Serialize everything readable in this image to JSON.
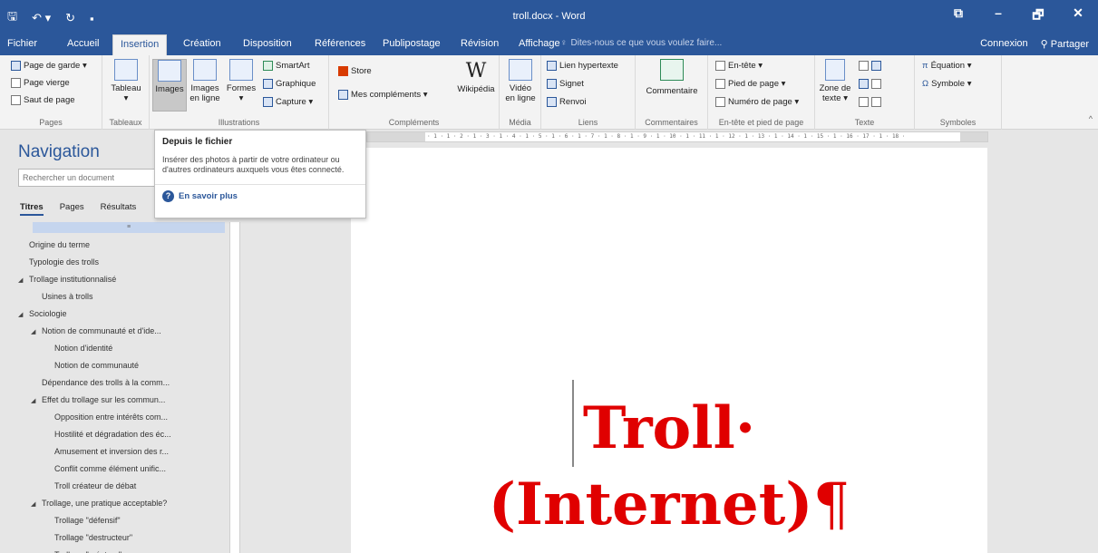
{
  "titlebar": {
    "doc_title": "troll.docx - Word",
    "qat_save": "🖫",
    "qat_undo": "↶ ▾",
    "qat_redo": "↻",
    "qat_more": "▪",
    "restore": "⧉",
    "minimize": "–",
    "maximize": "🗗",
    "close": "✕"
  },
  "tabs": {
    "fichier": "Fichier",
    "accueil": "Accueil",
    "insertion": "Insertion",
    "creation": "Création",
    "disposition": "Disposition",
    "references": "Références",
    "publipostage": "Publipostage",
    "revision": "Révision",
    "affichage": "Affichage",
    "tellme": "Dites-nous ce que vous voulez faire...",
    "connexion": "Connexion",
    "partager": "Partager"
  },
  "ribbon": {
    "pages": {
      "label": "Pages",
      "page_de_garde": "Page de garde ▾",
      "page_vierge": "Page vierge",
      "saut_de_page": "Saut de page"
    },
    "tableaux": {
      "label": "Tableaux",
      "tableau": "Tableau",
      "tableau_arrow": "▾"
    },
    "illustrations": {
      "label": "Illustrations",
      "images": "Images",
      "images_en_ligne_1": "Images",
      "images_en_ligne_2": "en ligne",
      "formes": "Formes",
      "formes_arrow": "▾",
      "smartart": "SmartArt",
      "graphique": "Graphique",
      "capture": "Capture ▾"
    },
    "complements": {
      "label": "Compléments",
      "store": "Store",
      "mes_complements": "Mes compléments ▾",
      "wikipedia": "Wikipédia",
      "wiki_glyph": "W"
    },
    "media": {
      "label": "Média",
      "video_1": "Vidéo",
      "video_2": "en ligne"
    },
    "liens": {
      "label": "Liens",
      "lien_hypertexte": "Lien hypertexte",
      "signet": "Signet",
      "renvoi": "Renvoi"
    },
    "commentaires": {
      "label": "Commentaires",
      "commentaire": "Commentaire"
    },
    "entete": {
      "label": "En-tête et pied de page",
      "en_tete": "En-tête ▾",
      "pied_de_page": "Pied de page ▾",
      "numero_de_page": "Numéro de page ▾"
    },
    "texte": {
      "label": "Texte",
      "zone_de_texte_1": "Zone de",
      "zone_de_texte_2": "texte ▾"
    },
    "symboles": {
      "label": "Symboles",
      "equation": "Équation ▾",
      "symbole": "Symbole ▾"
    }
  },
  "tooltip": {
    "title": "Depuis le fichier",
    "body": "Insérer des photos à partir de votre ordinateur ou d'autres ordinateurs auxquels vous êtes connecté.",
    "link": "En savoir plus"
  },
  "navigation": {
    "title": "Navigation",
    "search_placeholder": "Rechercher un document",
    "tabs": [
      "Titres",
      "Pages",
      "Résultats"
    ],
    "selected_marker": "≡",
    "items": [
      {
        "label": "Origine du terme",
        "level": 0,
        "expand": ""
      },
      {
        "label": "Typologie des trolls",
        "level": 0,
        "expand": ""
      },
      {
        "label": "Trollage institutionnalisé",
        "level": 0,
        "expand": "◢"
      },
      {
        "label": "Usines à trolls",
        "level": 1,
        "expand": ""
      },
      {
        "label": "Sociologie",
        "level": 0,
        "expand": "◢"
      },
      {
        "label": "Notion de communauté et d'ide...",
        "level": 1,
        "expand": "◢"
      },
      {
        "label": "Notion d'identité",
        "level": 2,
        "expand": ""
      },
      {
        "label": "Notion de communauté",
        "level": 2,
        "expand": ""
      },
      {
        "label": "Dépendance des trolls à la comm...",
        "level": 1,
        "expand": ""
      },
      {
        "label": "Effet du trollage sur les commun...",
        "level": 1,
        "expand": "◢"
      },
      {
        "label": "Opposition entre intérêts com...",
        "level": 2,
        "expand": ""
      },
      {
        "label": "Hostilité et dégradation des éc...",
        "level": 2,
        "expand": ""
      },
      {
        "label": "Amusement et inversion des r...",
        "level": 2,
        "expand": ""
      },
      {
        "label": "Conflit comme élément unific...",
        "level": 2,
        "expand": ""
      },
      {
        "label": "Troll créateur de débat",
        "level": 2,
        "expand": ""
      },
      {
        "label": "Trollage, une pratique acceptable?",
        "level": 1,
        "expand": "◢"
      },
      {
        "label": "Trollage \"défensif\"",
        "level": 2,
        "expand": ""
      },
      {
        "label": "Trollage \"destructeur\"",
        "level": 2,
        "expand": ""
      },
      {
        "label": "Trollage \"créateur\"",
        "level": 2,
        "expand": ""
      }
    ]
  },
  "ruler": {
    "ticks": "· 1 · 1 · 2 · 1 · 3 · 1 · 4 · 1 · 5 · 1 · 6 · 1 · 7 · 1 · 8 · 1 · 9 · 1 · 10 · 1 · 11 · 1 · 12 · 1 · 13 · 1 · 14 · 1 · 15 · 1 · 16 · 17 · 1 · 18 ·"
  },
  "document": {
    "heading_line1": "Troll·",
    "heading_line2": "(Internet)",
    "pilcrow": "¶"
  },
  "colors": {
    "accent": "#2b579a",
    "heading": "#e00000"
  }
}
